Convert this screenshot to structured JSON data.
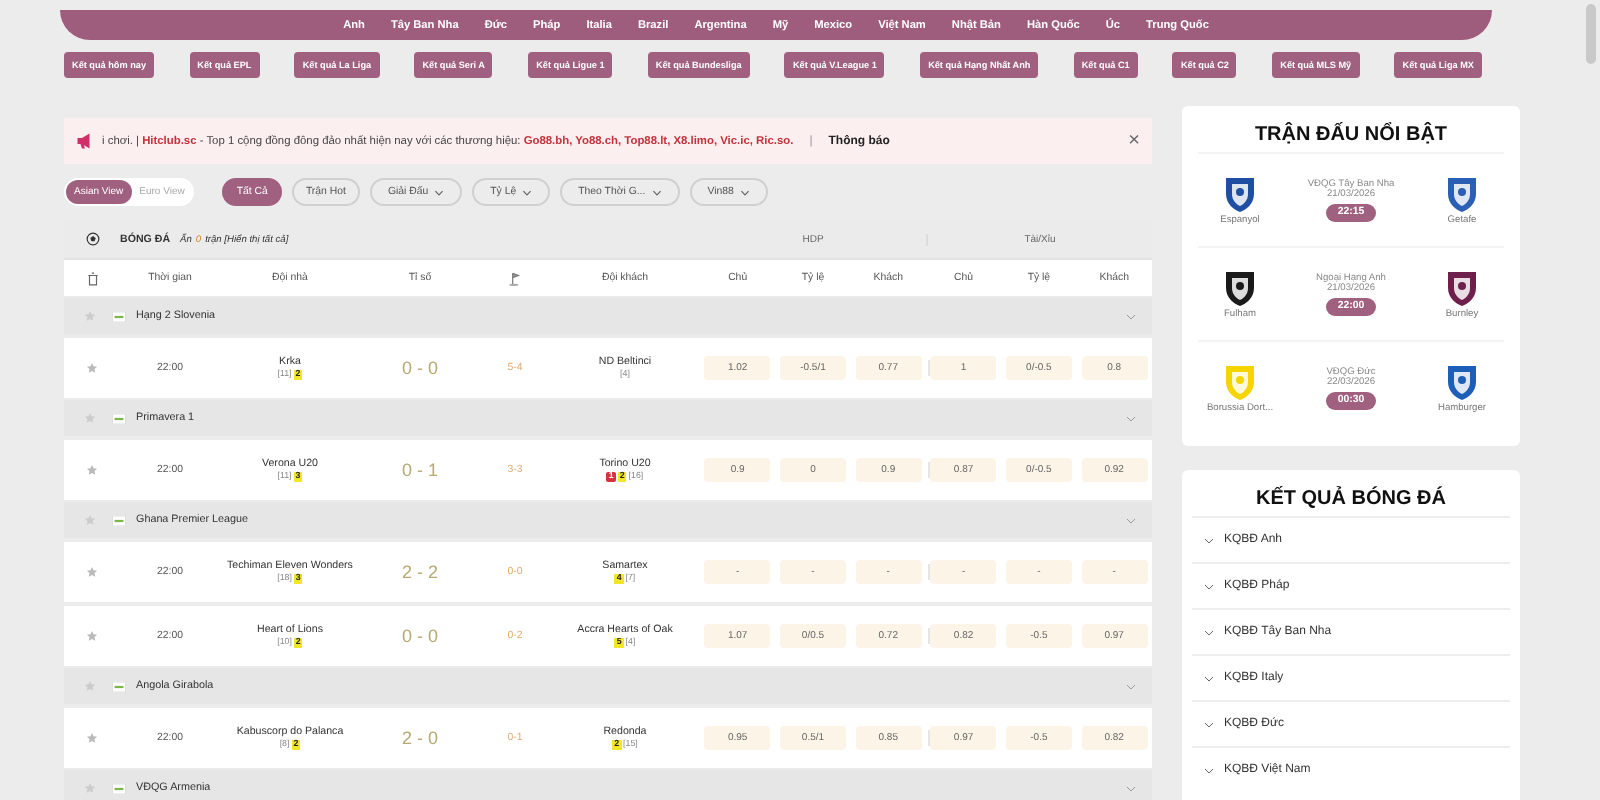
{
  "nav": {
    "countries": [
      "Anh",
      "Tây Ban Nha",
      "Đức",
      "Pháp",
      "Italia",
      "Brazil",
      "Argentina",
      "Mỹ",
      "Mexico",
      "Việt Nam",
      "Nhật Bản",
      "Hàn Quốc",
      "Úc",
      "Trung Quốc"
    ]
  },
  "quick_links": [
    "Kết quả hôm nay",
    "Kết quả EPL",
    "Kết quả La Liga",
    "Kết quả Seri A",
    "Kết quả Ligue 1",
    "Kết quả Bundesliga",
    "Kết quả V.League 1",
    "Kết quả Hạng Nhất Anh",
    "Kết quả C1",
    "Kết quả C2",
    "Kết quả MLS Mỹ",
    "Kết quả Liga MX"
  ],
  "announcement": {
    "text": "i chơi. | **Hitclub.sc** - Top 1 cộng đồng đông đảo nhất hiện nay với các thương hiệu: **Go88.bh, Yo88.ch, Top88.lt, X8.limo, Vic.ic, Ric.so.**",
    "separator": "|",
    "label": "Thông báo",
    "close": "×"
  },
  "filters": {
    "views": [
      {
        "label": "Asian View",
        "selected": true
      },
      {
        "label": "Euro View",
        "selected": false
      }
    ],
    "chips": [
      {
        "label": "Tất Cả",
        "kind": "pill",
        "selected": true
      },
      {
        "label": "Trận Hot",
        "kind": "pill",
        "selected": false
      },
      {
        "label": "Giải Đấu",
        "kind": "dropdown",
        "selected": false
      },
      {
        "label": "Tỷ Lệ",
        "kind": "dropdown",
        "selected": false
      },
      {
        "label": "Theo Thời G...",
        "kind": "dropdown",
        "selected": false
      },
      {
        "label": "Vin88",
        "kind": "dropdown",
        "selected": false
      }
    ]
  },
  "table": {
    "sport": "BÓNG ĐÁ",
    "hidden_prefix": "Ẩn",
    "hidden_count": "0",
    "hidden_suffix": "trận [Hiển thị tất cả]",
    "groups": [
      "HDP",
      "Tài/Xỉu"
    ],
    "columns": [
      "Thời gian",
      "Đội nhà",
      "Tỉ số",
      "Đội khách",
      "Chủ",
      "Tỷ lệ",
      "Khách",
      "Chủ",
      "Tỷ lệ",
      "Khách"
    ],
    "rows": [
      {
        "kind": "league",
        "name": "Hạng 2 Slovenia"
      },
      {
        "kind": "match",
        "time": "22:00",
        "home": {
          "name": "Krka",
          "tags": [
            {
              "kind": "rank",
              "text": "[11]"
            },
            {
              "kind": "yellow",
              "text": "2"
            }
          ]
        },
        "score": "0 - 0",
        "ht": "5-4",
        "away": {
          "name": "ND Beltinci",
          "tags": [
            {
              "kind": "rank",
              "text": "[4]"
            }
          ]
        },
        "odds": [
          "1.02",
          "-0.5/1",
          "0.77",
          "1",
          "0/-0.5",
          "0.8"
        ]
      },
      {
        "kind": "league",
        "name": "Primavera 1"
      },
      {
        "kind": "match",
        "time": "22:00",
        "home": {
          "name": "Verona U20",
          "tags": [
            {
              "kind": "rank",
              "text": "[11]"
            },
            {
              "kind": "yellow",
              "text": "3"
            }
          ]
        },
        "score": "0 - 1",
        "ht": "3-3",
        "away": {
          "name": "Torino U20",
          "tags": [
            {
              "kind": "red",
              "text": "1"
            },
            {
              "kind": "yellow",
              "text": "2"
            },
            {
              "kind": "rank",
              "text": "[16]"
            }
          ]
        },
        "odds": [
          "0.9",
          "0",
          "0.9",
          "0.87",
          "0/-0.5",
          "0.92"
        ]
      },
      {
        "kind": "league",
        "name": "Ghana Premier League"
      },
      {
        "kind": "match",
        "time": "22:00",
        "home": {
          "name": "Techiman Eleven Wonders",
          "tags": [
            {
              "kind": "rank",
              "text": "[18]"
            },
            {
              "kind": "yellow",
              "text": "3"
            }
          ]
        },
        "score": "2 - 2",
        "ht": "0-0",
        "away": {
          "name": "Samartex",
          "tags": [
            {
              "kind": "yellow",
              "text": "4"
            },
            {
              "kind": "rank",
              "text": "[7]"
            }
          ]
        },
        "odds": [
          "-",
          "-",
          "-",
          "-",
          "-",
          "-"
        ]
      },
      {
        "kind": "match",
        "time": "22:00",
        "home": {
          "name": "Heart of Lions",
          "tags": [
            {
              "kind": "rank",
              "text": "[10]"
            },
            {
              "kind": "yellow",
              "text": "2"
            }
          ]
        },
        "score": "0 - 0",
        "ht": "0-2",
        "away": {
          "name": "Accra Hearts of Oak",
          "tags": [
            {
              "kind": "yellow",
              "text": "5"
            },
            {
              "kind": "rank",
              "text": "[4]"
            }
          ]
        },
        "odds": [
          "1.07",
          "0/0.5",
          "0.72",
          "0.82",
          "-0.5",
          "0.97"
        ]
      },
      {
        "kind": "league",
        "name": "Angola Girabola"
      },
      {
        "kind": "match",
        "time": "22:00",
        "home": {
          "name": "Kabuscorp do Palanca",
          "tags": [
            {
              "kind": "rank",
              "text": "[8]"
            },
            {
              "kind": "yellow",
              "text": "2"
            }
          ]
        },
        "score": "2 - 0",
        "ht": "0-1",
        "away": {
          "name": "Redonda",
          "tags": [
            {
              "kind": "yellow",
              "text": "2"
            },
            {
              "kind": "rank",
              "text": "[15]"
            }
          ]
        },
        "odds": [
          "0.95",
          "0.5/1",
          "0.85",
          "0.97",
          "-0.5",
          "0.82"
        ]
      },
      {
        "kind": "league",
        "name": "VĐQG Armenia"
      }
    ]
  },
  "featured": {
    "title": "TRẬN ĐẤU NỔI BẬT",
    "matches": [
      {
        "home": {
          "name": "Espanyol",
          "color": "#1f4fa3"
        },
        "league": "VĐQG Tây Ban Nha",
        "date": "21/03/2026",
        "time": "22:15",
        "away": {
          "name": "Getafe",
          "color": "#2a5fb5"
        }
      },
      {
        "home": {
          "name": "Fulham",
          "color": "#1a1a1a"
        },
        "league": "Ngoại Hạng Anh",
        "date": "21/03/2026",
        "time": "22:00",
        "away": {
          "name": "Burnley",
          "color": "#6e1f4b"
        }
      },
      {
        "home": {
          "name": "Borussia Dort...",
          "color": "#f5d400"
        },
        "league": "VĐQG Đức",
        "date": "22/03/2026",
        "time": "00:30",
        "away": {
          "name": "Hamburger",
          "color": "#1d5fb8"
        }
      }
    ]
  },
  "results": {
    "title": "KẾT QUẢ BÓNG ĐÁ",
    "items": [
      "KQBĐ Anh",
      "KQBĐ Pháp",
      "KQBĐ Tây Ban Nha",
      "KQBĐ Italy",
      "KQBĐ Đức",
      "KQBĐ Việt Nam"
    ]
  }
}
